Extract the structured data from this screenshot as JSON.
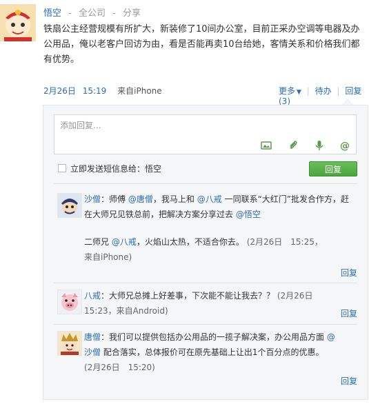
{
  "post": {
    "author": "悟空",
    "scope": "全公司",
    "dot": "-",
    "share": "分享",
    "text": "铁扇公主经营规模有所扩大，新装修了10间办公室，目前正采办空调等电器及办公用品，俺以老客户回访为由，看是否能再卖10台给她，客情关系和价格我们都有优势。",
    "date": "2月26日",
    "time": "15:19",
    "source": "来自iPhone",
    "actions": {
      "more": "更多",
      "todo": "待办",
      "reply": "回复(3)",
      "sep": "|"
    }
  },
  "composer": {
    "placeholder": "添加回复...",
    "sms_label": "立即发送短信息给：悟空",
    "submit": "回复",
    "icons": [
      "image-icon",
      "attachment-icon",
      "microphone-icon",
      "at-icon"
    ]
  },
  "comments": [
    {
      "author": "沙僧",
      "parts": [
        "：师傅",
        "@唐僧",
        "，我马上和",
        "@八戒",
        "一同联系“大红门”批发合作方，赶在大师兄见铁总前，把解决方案分享过去",
        "@悟空"
      ],
      "sub": {
        "prefix": "二师兄",
        "mention": "@八戒",
        "text": "，火焰山太热，不适合你去。",
        "meta": "(2月26日　15:25，",
        "source": "来自iPhone)"
      },
      "reply": "回复"
    },
    {
      "author": "八戒",
      "text": "：大师兄总摊上好差事，下次能不能让我去？？",
      "meta": "(2月26日",
      "meta2": "15:23，来自Android)",
      "reply": "回复"
    },
    {
      "author": "唐僧",
      "text": "：我们可以提供包括办公用品的一揽子解决案，办公用品方面",
      "mention": "@",
      "mention2": "沙僧",
      "text2": "配合落实，总体报价可在原先基础上让出1个百分点的优惠。",
      "meta": "(2月26日　15:20)",
      "reply": "回复"
    }
  ],
  "colors": {
    "link": "#2a6bb4",
    "button_green": "#4aa63d",
    "panel_bg": "#f5f6f7"
  }
}
